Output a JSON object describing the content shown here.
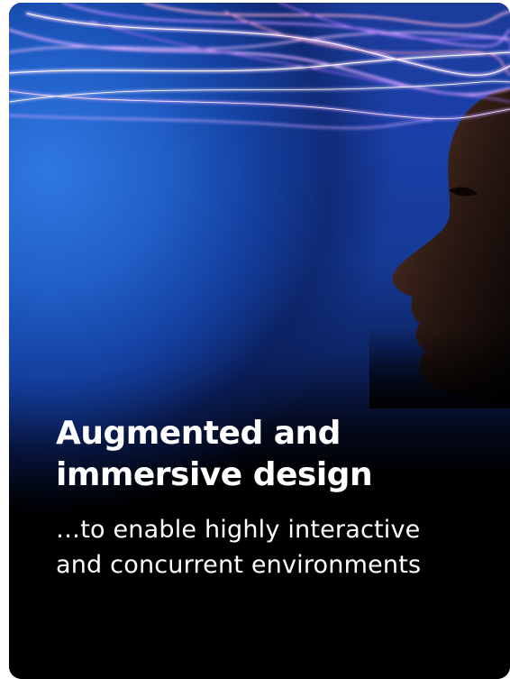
{
  "card": {
    "headline_line1": "Augmented and",
    "headline_line2": "immersive design",
    "subline_line1": "…to enable highly interactive",
    "subline_line2": "and concurrent environments",
    "image": "woman-profile-with-light-streaks-image"
  },
  "colors": {
    "background_top": "#2160c8",
    "background_bottom": "#000000",
    "text": "#ffffff",
    "light_streaks": "#c89cff"
  }
}
